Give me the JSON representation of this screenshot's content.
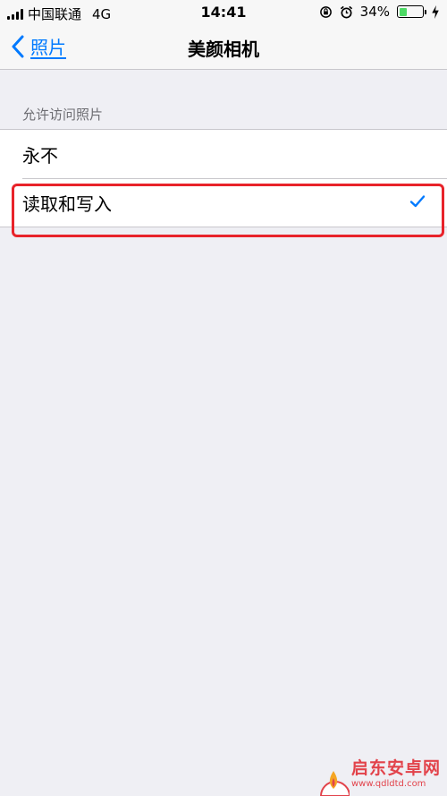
{
  "status_bar": {
    "carrier": "中国联通",
    "network": "4G",
    "time": "14:41",
    "battery_percent": "34%",
    "battery_level": 0.34,
    "battery_color": "#4cd964"
  },
  "nav": {
    "back_label": "照片",
    "title": "美颜相机",
    "accent_color": "#007aff"
  },
  "section": {
    "header": "允许访问照片",
    "options": [
      {
        "label": "永不",
        "selected": false
      },
      {
        "label": "读取和写入",
        "selected": true
      }
    ]
  },
  "annotation": {
    "highlight_color": "#e8232a"
  },
  "watermark": {
    "name": "启东安卓网",
    "url": "www.qdldtd.com"
  }
}
